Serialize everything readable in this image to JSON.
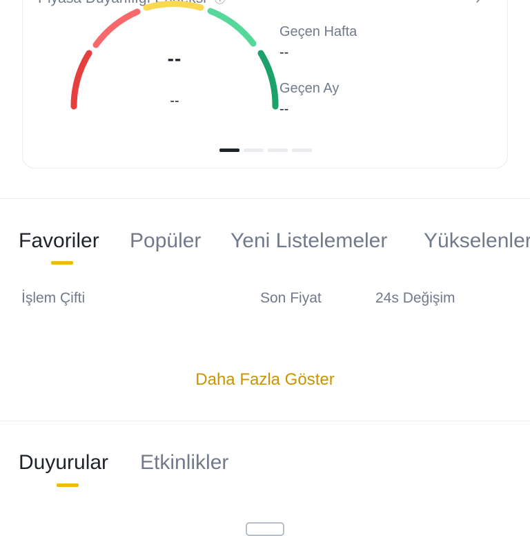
{
  "sentiment_card": {
    "title": "Piyasa Duyarlılığı Endeksi",
    "main_value": "--",
    "sub_value": "--",
    "last_week_label": "Geçen Hafta",
    "last_week_value": "--",
    "last_month_label": "Geçen Ay",
    "last_month_value": "--",
    "gauge_colors": [
      "#e5403f",
      "#f6686a",
      "#fad850",
      "#56d89a",
      "#1ba169"
    ],
    "pagination": {
      "pages": 4,
      "active": 1
    }
  },
  "market_tabs": {
    "tabs": [
      "Favoriler",
      "Popüler",
      "Yeni Listelemeler",
      "Yükselenler"
    ],
    "active": "Favoriler"
  },
  "market_table": {
    "columns": [
      "İşlem Çifti",
      "Son Fiyat",
      "24s Değişim"
    ]
  },
  "show_more": "Daha Fazla Göster",
  "news_tabs": {
    "tabs": [
      "Duyurular",
      "Etkinlikler"
    ],
    "active": "Duyurular"
  },
  "colors": {
    "accent": "#f0b90b",
    "link": "#c99400",
    "text_primary": "#1e2329",
    "text_secondary": "#707a8a",
    "divider": "#eaecef"
  }
}
